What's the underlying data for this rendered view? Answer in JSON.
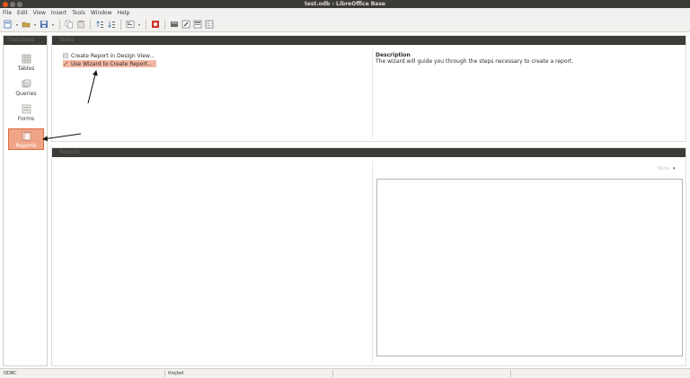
{
  "window": {
    "title": "test.odb - LibreOffice Base"
  },
  "menubar": {
    "items": [
      "File",
      "Edit",
      "View",
      "Insert",
      "Tools",
      "Window",
      "Help"
    ]
  },
  "toolbar": {
    "buttons": [
      "new-document-icon",
      "open-icon",
      "save-icon",
      "copy-icon",
      "paste-icon",
      "sort-ascending-icon",
      "sort-descending-icon",
      "form-icon",
      "database-icon",
      "query-icon",
      "edit-icon",
      "report-icon",
      "table-icon"
    ]
  },
  "sidebar": {
    "header": "Database",
    "items": [
      {
        "label": "Tables",
        "icon": "tables-icon",
        "active": false
      },
      {
        "label": "Queries",
        "icon": "queries-icon",
        "active": false
      },
      {
        "label": "Forms",
        "icon": "forms-icon",
        "active": false
      },
      {
        "label": "Reports",
        "icon": "reports-icon",
        "active": true
      }
    ]
  },
  "tasks": {
    "header": "Tasks",
    "items": [
      {
        "label": "Create Report in Design View...",
        "icon": "design-view-icon",
        "selected": false
      },
      {
        "label": "Use Wizard to Create Report...",
        "icon": "wizard-icon",
        "selected": true
      }
    ],
    "description_title": "Description",
    "description_text": "The wizard will guide you through the steps necessary to create a report."
  },
  "reports": {
    "header": "Reports",
    "preview_option": "None"
  },
  "statusbar": {
    "connection": "ODBC",
    "user": "thejled"
  },
  "colors": {
    "titlebar_bg": "#3c3b37",
    "accent": "#e9541f",
    "selection": "#f4b7a2",
    "active_nav": "#f0a487"
  }
}
